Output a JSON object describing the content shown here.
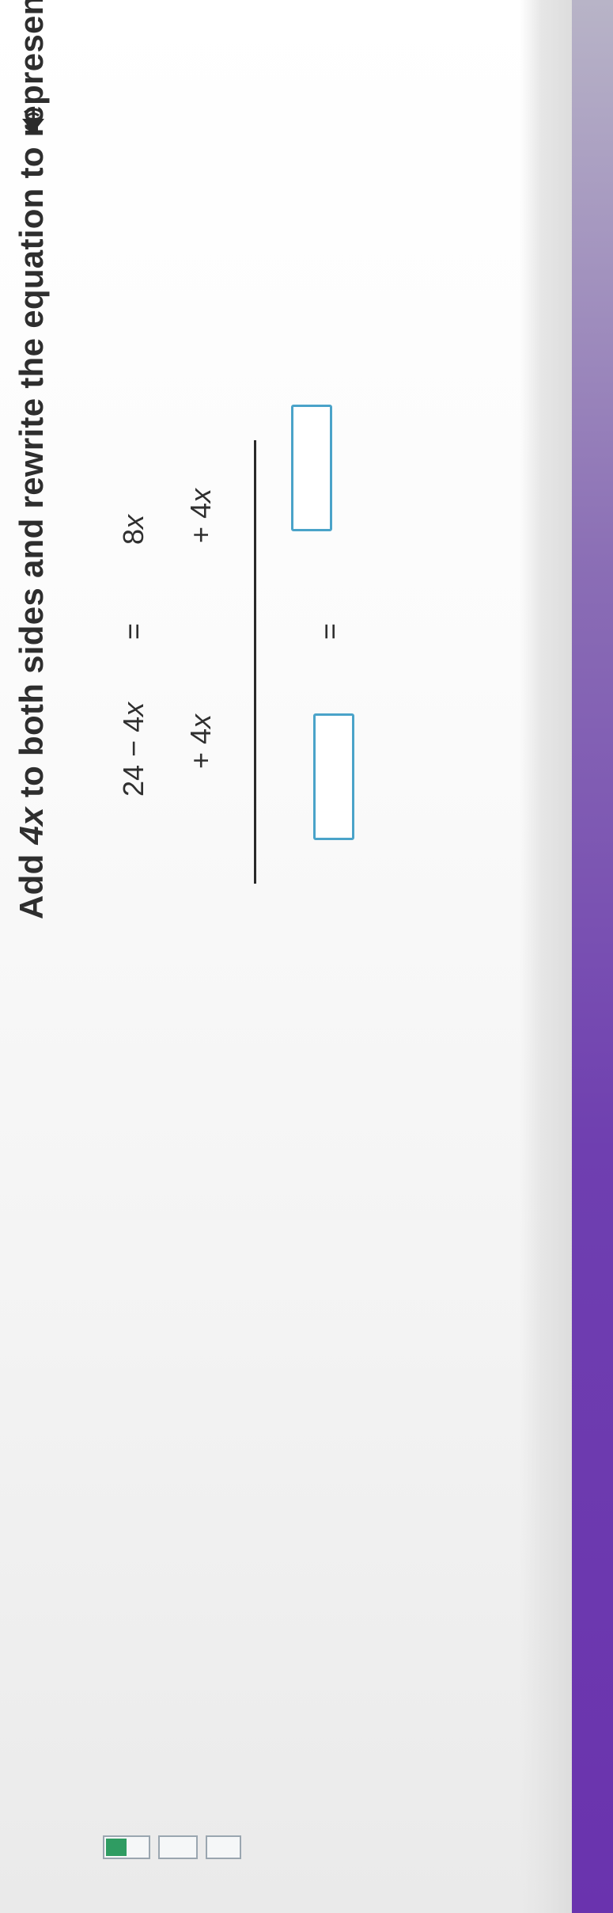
{
  "instruction": {
    "before": "Add ",
    "term": "4x",
    "after": " to both sides and rewrite the equation to represent the values that remain."
  },
  "speaker_icon": "speaker-icon",
  "equation": {
    "row1": {
      "left_a": "24 − 4",
      "left_var": "x",
      "equals": "=",
      "right_a": "8",
      "right_var": "x"
    },
    "row2": {
      "left_a": "+ 4",
      "left_var": "x",
      "right_a": "+ 4",
      "right_var": "x"
    },
    "row3": {
      "equals": "=",
      "left_value": "",
      "right_value": ""
    }
  },
  "colors": {
    "input_border": "#4aa3c9",
    "progress_fill": "#2f9c62",
    "edge": "#6a33ae"
  },
  "progress": {
    "filled_fraction": 0.5
  }
}
